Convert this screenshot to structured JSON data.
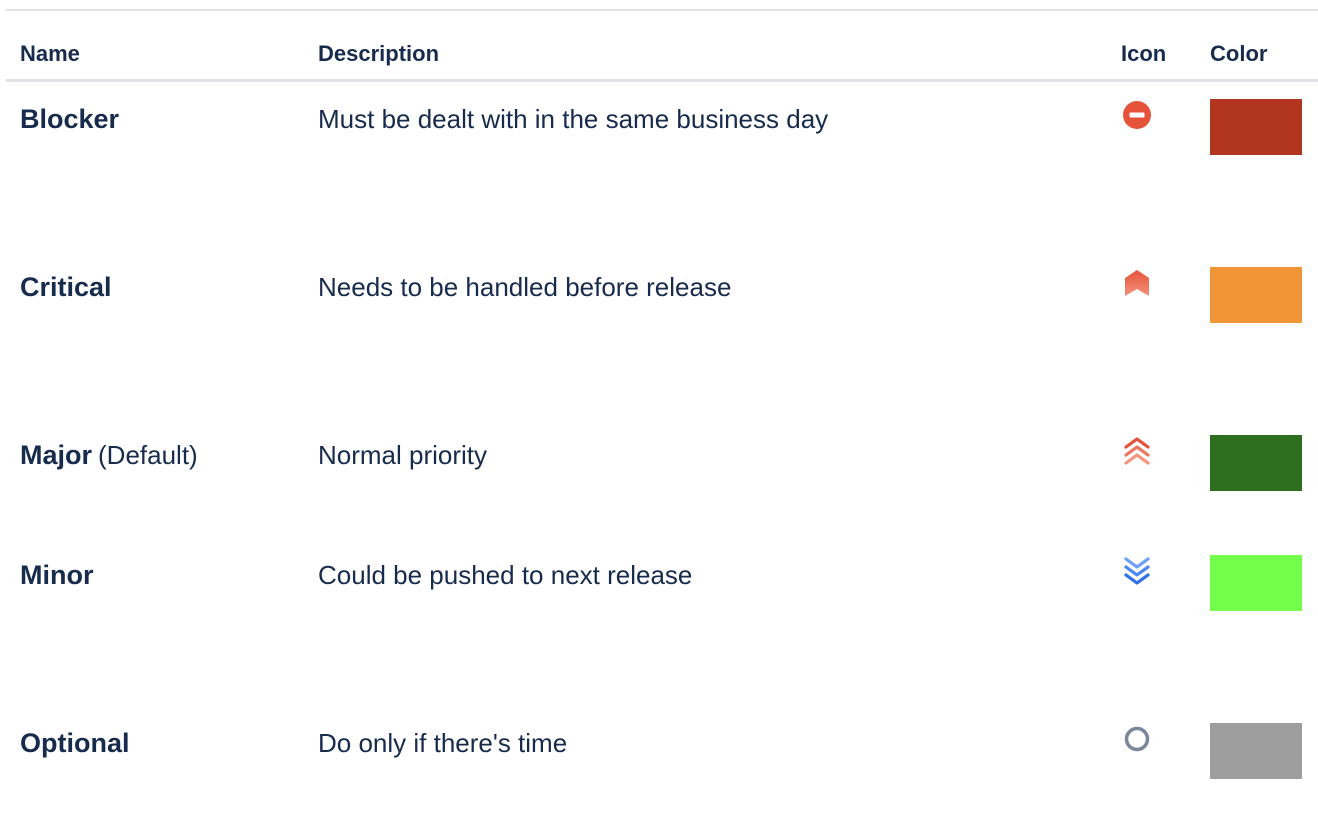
{
  "table": {
    "headers": {
      "name": "Name",
      "description": "Description",
      "icon": "Icon",
      "color": "Color"
    },
    "rows": [
      {
        "name": "Blocker",
        "default_label": "",
        "description": "Must be dealt with in the same business day",
        "icon": "blocker-icon",
        "color": "#b2361f"
      },
      {
        "name": "Critical",
        "default_label": "",
        "description": "Needs to be handled before release",
        "icon": "critical-icon",
        "color": "#f29537"
      },
      {
        "name": "Major",
        "default_label": "(Default)",
        "description": "Normal priority",
        "icon": "major-icon",
        "color": "#2d6f1e"
      },
      {
        "name": "Minor",
        "default_label": "",
        "description": "Could be pushed to next release",
        "icon": "minor-icon",
        "color": "#74ff4c"
      },
      {
        "name": "Optional",
        "default_label": "",
        "description": "Do only if there's time",
        "icon": "optional-icon",
        "color": "#9e9e9e"
      }
    ]
  }
}
